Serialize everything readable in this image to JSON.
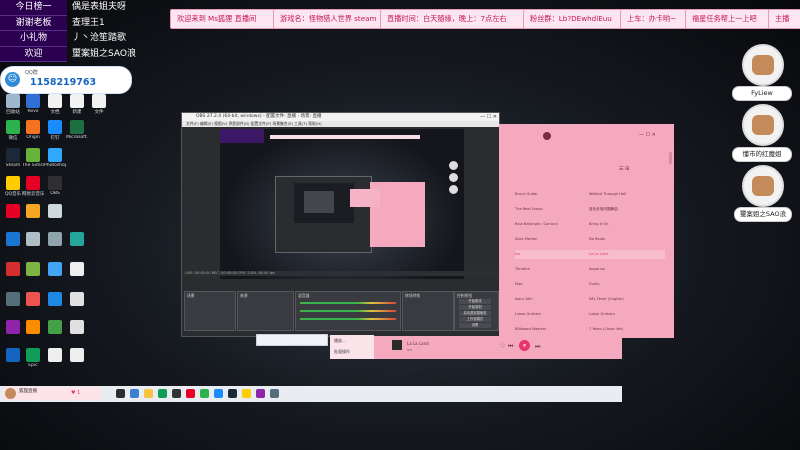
{
  "overlay_board": {
    "rows": [
      {
        "label": "今日榜一",
        "value": "偶是表姐夫呀"
      },
      {
        "label": "谢谢老板",
        "value": "查理王1"
      },
      {
        "label": "小礼物",
        "value": "丿丶沧笙踏歌"
      },
      {
        "label": "欢迎",
        "value": "璽案姐之SAO浪"
      }
    ]
  },
  "top_bar": [
    "欢迎来到 Ms狐狸 直播间",
    "游戏名：怪物猎人世界 steam",
    "直播时间：白天随缘，晚上：7点左右",
    "粉丝群：Lb?DEwhdlEuu",
    "上车：办卡哟~",
    "福星任务帮上一上吧",
    "主播"
  ],
  "qq": {
    "label": "QQ群",
    "number": "1158219763"
  },
  "desktop_icons": [
    {
      "label": "回收站",
      "color": "#9fb7cc"
    },
    {
      "label": "Revo",
      "color": "#2f6fd6"
    },
    {
      "label": "文档",
      "color": "#f2f2f2"
    },
    {
      "label": "新建",
      "color": "#f2f2f2"
    },
    {
      "label": "微信",
      "color": "#2bb24c"
    },
    {
      "label": "Origin",
      "color": "#f47321"
    },
    {
      "label": "钉钉",
      "color": "#1a8cff"
    },
    {
      "label": "Microsoft...",
      "color": "#1d6f42"
    },
    {
      "label": "Steam",
      "color": "#1b2838"
    },
    {
      "label": "The Sims4",
      "color": "#67b33a"
    },
    {
      "label": "Photoshop",
      "color": "#31a8ff"
    },
    {
      "label": "QQ音乐",
      "color": "#ffcd00"
    },
    {
      "label": "网易云音乐",
      "color": "#e60026"
    },
    {
      "label": "OBS",
      "color": "#302e31"
    },
    {
      "label": "文件",
      "color": "#f2f2f2"
    },
    {
      "label": "Epic",
      "color": "#2a2a2a"
    }
  ],
  "obs": {
    "title": "OBS 27.2.4 (64-bit, windows) - 配置文件: 直播 - 场景: 直播",
    "menu": "文件(F)  编辑(E)  视图(V)  停靠部件(D)  配置文件(P)  场景集合(S)  工具(T)  帮助(H)",
    "docks": [
      "场景",
      "来源",
      "混音器",
      "转场特效",
      "控制按钮"
    ],
    "controls": [
      "开始推流",
      "开始录制",
      "启动虚拟摄像机",
      "工作室模式",
      "设置",
      "退出"
    ],
    "status": "LIVE: 00:00:00  REC: 00:00:00  CPU: 2.8%, 60.00 fps"
  },
  "music": {
    "rows": [
      {
        "artist": "Bruce Guitar",
        "song": "Walked Through Hell"
      },
      {
        "artist": "The Real Group",
        "song": "蓝色多瑙河圆舞曲"
      },
      {
        "artist": "Raul Bafunghi / Carlucci",
        "song": "Bring It On"
      },
      {
        "artist": "Alice Merton",
        "song": "No Roots"
      },
      {
        "artist": "Ice",
        "song": "La La Land"
      },
      {
        "artist": "Timothe",
        "song": "Aquarius"
      },
      {
        "artist": "Mao",
        "song": "Guilty"
      },
      {
        "artist": "Isacu Atin",
        "song": "NFL Fever (English)"
      },
      {
        "artist": "Lukas Graham",
        "song": "Lukas Graham"
      },
      {
        "artist": "Billboard Masters",
        "song": "7 Years (Cover Ver)"
      }
    ],
    "now_playing": "La La Land",
    "now_playing_artist": "Ice"
  },
  "context_menu": [
    "播放...",
    "批量操作"
  ],
  "taskbar": {
    "live_label": "狐狸直播",
    "counter": "♥ 1"
  },
  "avatars": [
    {
      "name": "FyLiew"
    },
    {
      "name": "懂市的红魔姐"
    },
    {
      "name": "璽案姐之SAO浪"
    }
  ]
}
